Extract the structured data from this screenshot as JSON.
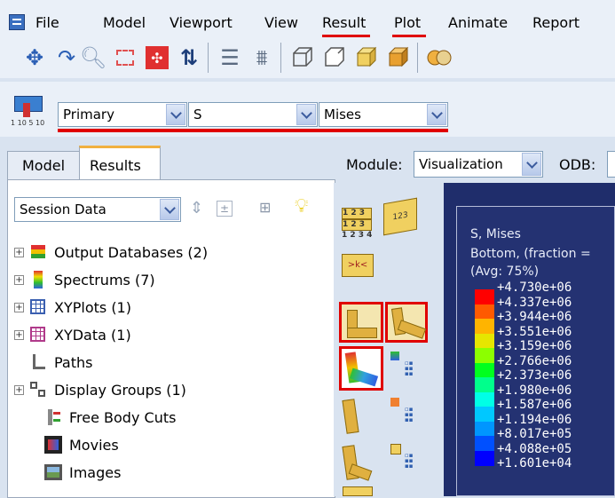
{
  "menu": {
    "items": [
      {
        "label": "File",
        "underlined": true
      },
      {
        "label": "Model",
        "underlined": true
      },
      {
        "label": "Viewport",
        "underlined": true
      },
      {
        "label": "View",
        "underlined": true
      },
      {
        "label": "Result",
        "underlined": true
      },
      {
        "label": "Plot",
        "underlined": true
      },
      {
        "label": "Animate",
        "underlined": true
      },
      {
        "label": "Report",
        "underlined": true
      }
    ]
  },
  "field_output": {
    "step": "Primary",
    "variable": "S",
    "component": "Mises"
  },
  "left_tabs": {
    "model": "Model",
    "results": "Results"
  },
  "session": {
    "value": "Session Data"
  },
  "tree": [
    {
      "label": "Output Databases (2)",
      "expandable": true,
      "icon": "output-databases-icon"
    },
    {
      "label": "Spectrums (7)",
      "expandable": true,
      "icon": "spectrums-icon"
    },
    {
      "label": "XYPlots (1)",
      "expandable": true,
      "icon": "xyplots-icon"
    },
    {
      "label": "XYData (1)",
      "expandable": true,
      "icon": "xydata-icon"
    },
    {
      "label": "Paths",
      "expandable": false,
      "icon": "paths-icon"
    },
    {
      "label": "Display Groups (1)",
      "expandable": true,
      "icon": "display-groups-icon"
    },
    {
      "label": "Free Body Cuts",
      "expandable": false,
      "icon": "free-body-cuts-icon"
    },
    {
      "label": "Movies",
      "expandable": false,
      "icon": "movies-icon"
    },
    {
      "label": "Images",
      "expandable": false,
      "icon": "images-icon"
    }
  ],
  "module_bar": {
    "module_label": "Module:",
    "module_value": "Visualization",
    "odb_label": "ODB:"
  },
  "legend": {
    "title": "S, Mises",
    "line2": "Bottom, (fraction =",
    "line3": "(Avg: 75%)",
    "values": [
      "+4.730e+06",
      "+4.337e+06",
      "+3.944e+06",
      "+3.551e+06",
      "+3.159e+06",
      "+2.766e+06",
      "+2.373e+06",
      "+1.980e+06",
      "+1.587e+06",
      "+1.194e+06",
      "+8.017e+05",
      "+4.088e+05",
      "+1.601e+04"
    ],
    "colors": [
      "#ff0000",
      "#ff5a00",
      "#ffb400",
      "#e6e600",
      "#8cff00",
      "#00ff1e",
      "#00ff8c",
      "#00ffe6",
      "#00c8ff",
      "#0096ff",
      "#0050ff",
      "#0000ff"
    ]
  },
  "accent": {
    "highlight": "#e00000",
    "viewport_bg": "#1f2d6b"
  }
}
